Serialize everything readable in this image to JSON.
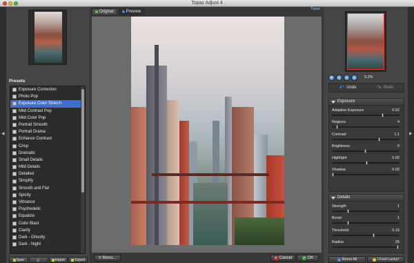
{
  "window": {
    "title": "Topaz Adjust 4"
  },
  "left": {
    "presets_title": "Presets",
    "presets": [
      "Exposure Correction",
      "Photo Pop",
      "Exposure Color Stretch",
      "Mild Contrast Pop",
      "Mild Color Pop",
      "Portrait Smooth",
      "Portrait Drama",
      "Enhance Contrast",
      "Crisp",
      "Dramatic",
      "Small Details",
      "Mild Details",
      "Detailed",
      "Simplify",
      "Smooth and Flat",
      "Spicify",
      "Vibrance",
      "Psychedelic",
      "Equalize",
      "Color Blast",
      "Clarity",
      "Dark - Ghostly",
      "Dark - Night"
    ],
    "selected_index": 2,
    "buttons": {
      "save": "Save",
      "delete": "",
      "import": "Import",
      "export": "Export"
    }
  },
  "center": {
    "tabs": {
      "original": "Original",
      "preview": "Preview"
    },
    "logo": "Topaz",
    "menu_label": "Menu...",
    "cancel_label": "Cancel",
    "ok_label": "OK"
  },
  "right": {
    "zoom": "9.2%",
    "undo_label": "Undo",
    "redo_label": "Redo",
    "exposure": {
      "title": "Exposure",
      "sliders": [
        {
          "label": "Adaptive Exposure",
          "value": "0.52",
          "fraction": 0.75
        },
        {
          "label": "Regions",
          "value": "4",
          "fraction": 0.08
        },
        {
          "label": "Contrast",
          "value": "1.1",
          "fraction": 0.7
        },
        {
          "label": "Brightness",
          "value": "0",
          "fraction": 0.5
        },
        {
          "label": "Highlight",
          "value": "0.02",
          "fraction": 0.52
        },
        {
          "label": "Shadow",
          "value": "0.02",
          "fraction": 0.02
        }
      ]
    },
    "details": {
      "title": "Details",
      "sliders": [
        {
          "label": "Strength",
          "value": "1",
          "fraction": 0.24
        },
        {
          "label": "Boost",
          "value": "1",
          "fraction": 0.24
        },
        {
          "label": "Threshold",
          "value": "0.15",
          "fraction": 0.62
        },
        {
          "label": "Radius",
          "value": "25",
          "fraction": 0.98
        }
      ]
    },
    "reset_all": "Reset All",
    "feel_lucky": "I Feel Lucky!"
  },
  "colors": {
    "selection": "#3e6fd0",
    "nav_box": "#e03a30",
    "accent_blue": "#4a8fdf"
  }
}
